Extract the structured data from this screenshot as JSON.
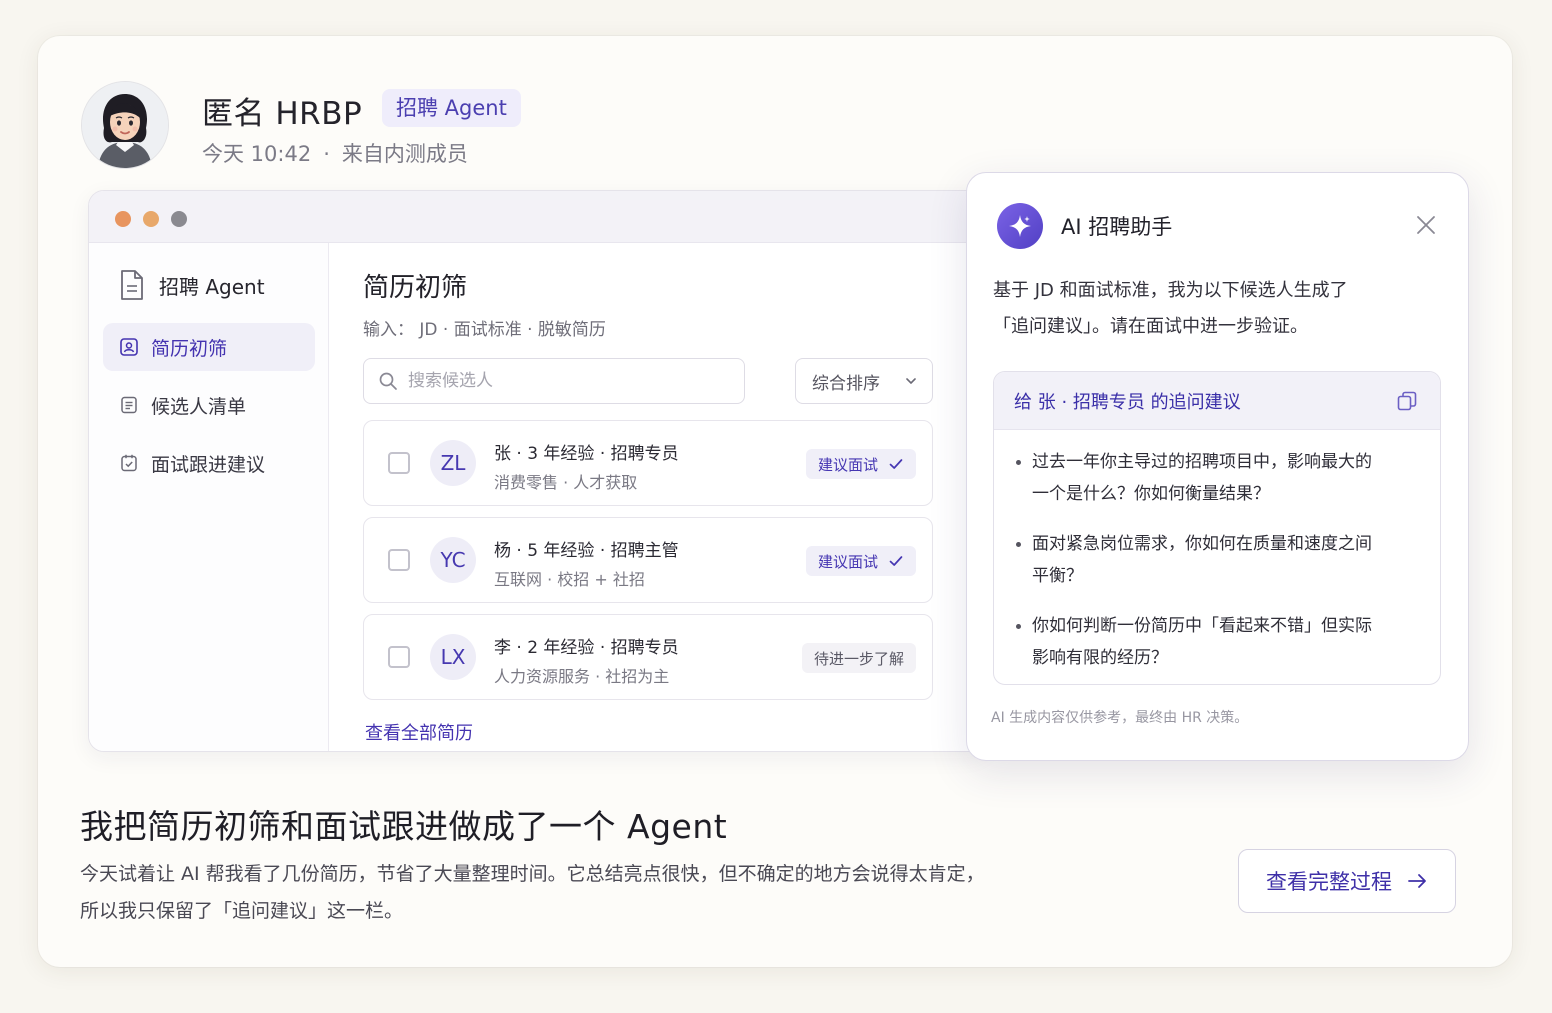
{
  "post": {
    "author": "匿名 HRBP",
    "tag": "招聘 Agent",
    "time": "今天 10:42",
    "source": "来自内测成员",
    "title": "我把简历初筛和面试跟进做成了一个 Agent",
    "body_line1": "今天试着让 AI 帮我看了几份简历，节省了大量整理时间。它总结亮点很快，但不确定的地方会说得太肯定，",
    "body_line2": "所以我只保留了「追问建议」这一栏。",
    "cta": "查看完整过程"
  },
  "app": {
    "sidebar": {
      "title": "招聘 Agent",
      "items": [
        {
          "label": "简历初筛",
          "active": true
        },
        {
          "label": "候选人清单",
          "active": false
        },
        {
          "label": "面试跟进建议",
          "active": false
        }
      ]
    },
    "main": {
      "title": "简历初筛",
      "subtitle": "输入： JD · 面试标准 · 脱敏简历",
      "search_placeholder": "搜索候选人",
      "sort_label": "综合排序",
      "candidates": [
        {
          "initials": "ZL",
          "line1": "张 · 3 年经验 · 招聘专员",
          "line2": "消费零售 · 人才获取",
          "status": "建议面试",
          "checked": false
        },
        {
          "initials": "YC",
          "line1": "杨 · 5 年经验 · 招聘主管",
          "line2": "互联网 · 校招 + 社招",
          "status": "建议面试",
          "checked": false
        },
        {
          "initials": "LX",
          "line1": "李 · 2 年经验 · 招聘专员",
          "line2": "人力资源服务 · 社招为主",
          "status": "待进一步了解",
          "checked": false
        }
      ],
      "view_all": "查看全部简历"
    }
  },
  "assistant": {
    "title": "AI 招聘助手",
    "intro_line1": "基于 JD 和面试标准，我为以下候选人生成了",
    "intro_line2": "「追问建议」。请在面试中进一步验证。",
    "card_title": "给 张 · 招聘专员 的追问建议",
    "questions": [
      {
        "l1": "过去一年你主导过的招聘项目中，影响最大的",
        "l2": "一个是什么？你如何衡量结果？"
      },
      {
        "l1": "面对紧急岗位需求，你如何在质量和速度之间",
        "l2": "平衡？"
      },
      {
        "l1": "你如何判断一份简历中「看起来不错」但实际",
        "l2": "影响有限的经历？"
      }
    ],
    "footer": "AI 生成内容仅供参考，最终由 HR 决策。"
  },
  "colors": {
    "accent": "#4433b0",
    "traffic_red": "#e8955f",
    "traffic_yellow": "#e8a86a",
    "traffic_gray": "#8a8a90"
  }
}
